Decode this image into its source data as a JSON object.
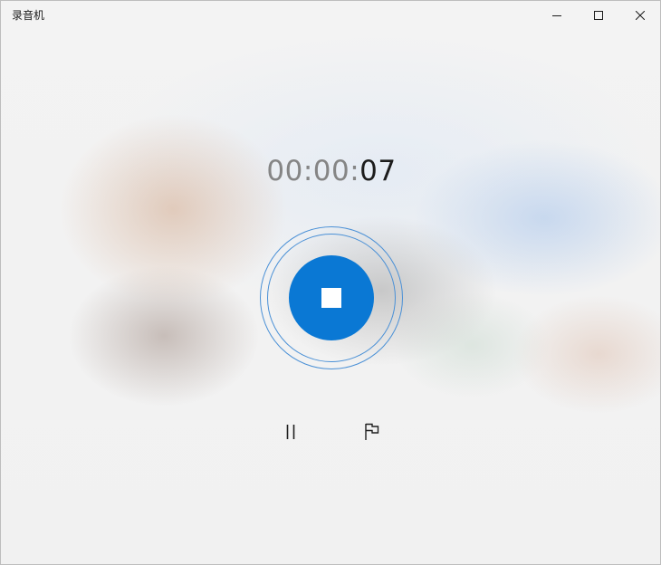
{
  "window": {
    "title": "录音机"
  },
  "titlebar": {
    "icons": [
      "minimize-icon",
      "maximize-icon",
      "close-icon"
    ]
  },
  "timer": {
    "dim_part": "00:00:",
    "bright_part": "07"
  },
  "controls": {
    "record_icon": "stop-icon",
    "pause_icon": "pause-icon",
    "marker_icon": "flag-icon"
  },
  "colors": {
    "accent": "#0a78d4",
    "ring": "#4a90d6",
    "timer_dim": "#858585",
    "timer_bright": "#1c1c1c"
  }
}
